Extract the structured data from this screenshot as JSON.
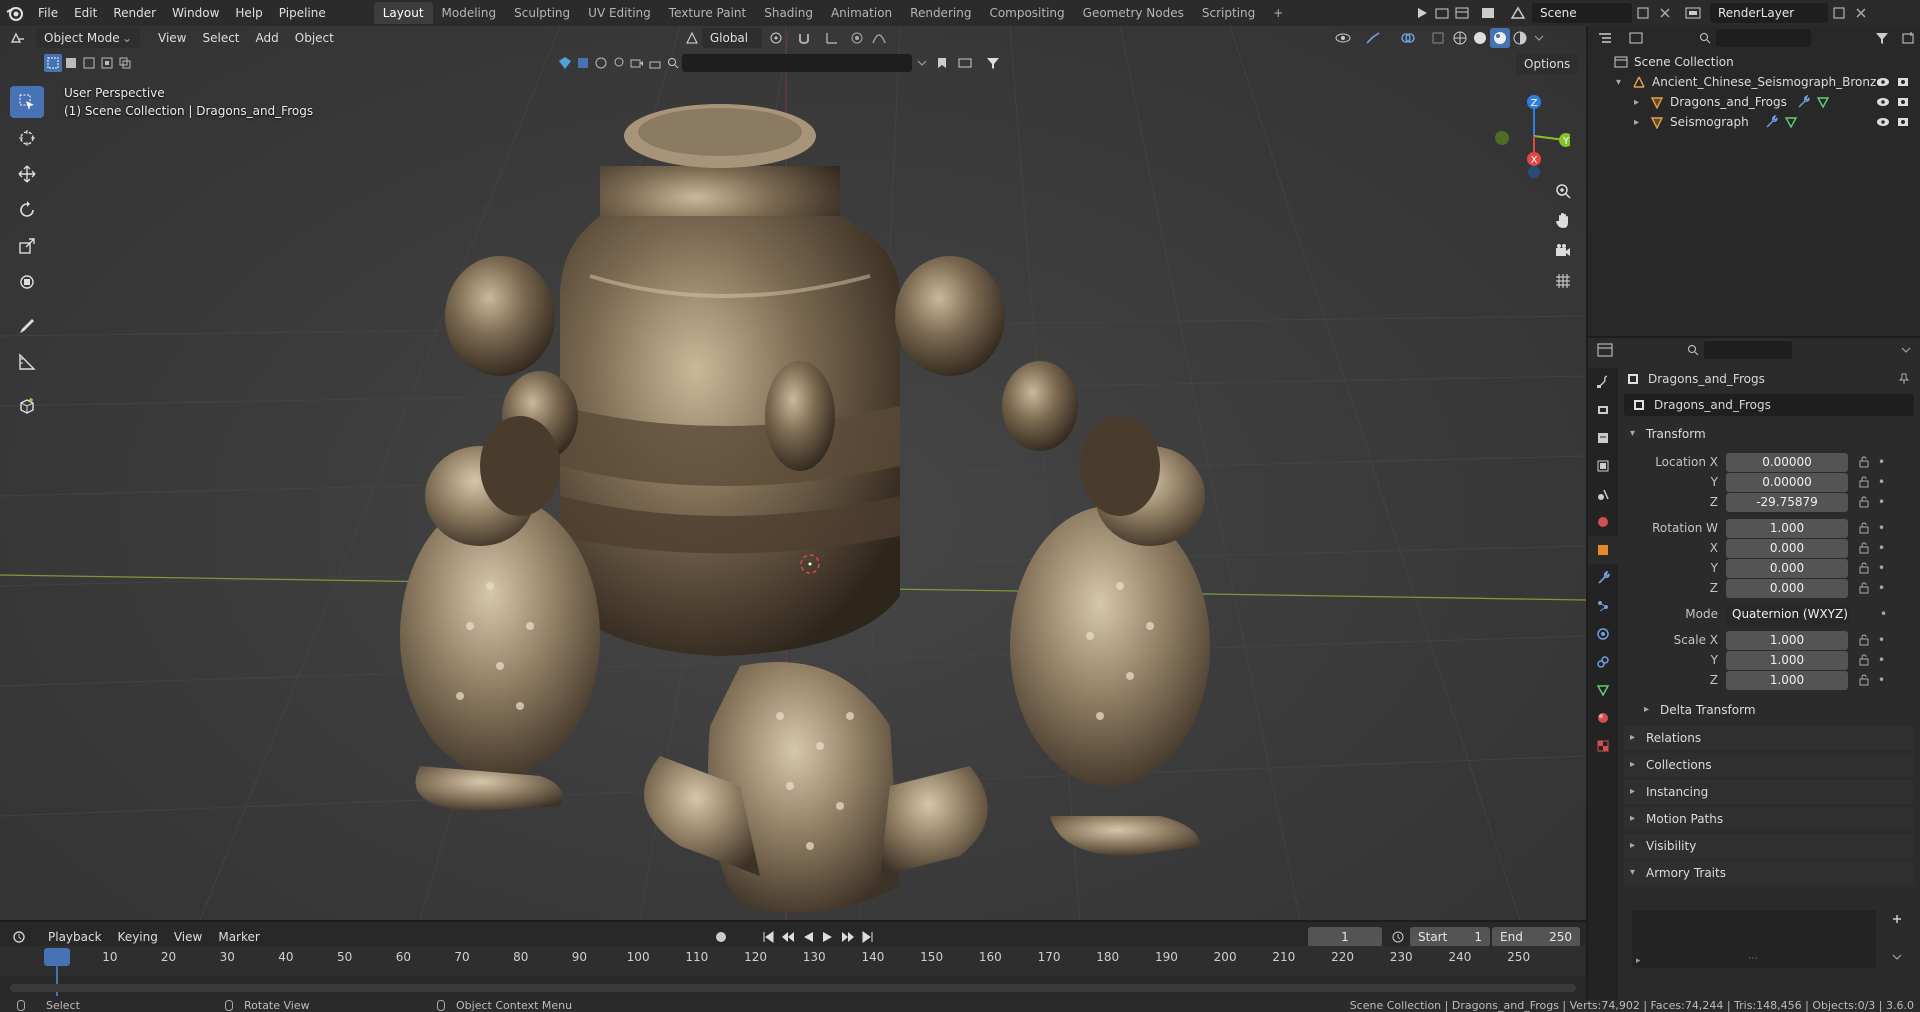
{
  "menubar": {
    "items": [
      "File",
      "Edit",
      "Render",
      "Window",
      "Help",
      "Pipeline"
    ],
    "workspaces": [
      "Layout",
      "Modeling",
      "Sculpting",
      "UV Editing",
      "Texture Paint",
      "Shading",
      "Animation",
      "Rendering",
      "Compositing",
      "Geometry Nodes",
      "Scripting"
    ],
    "active_workspace": "Layout",
    "add_tab": "+",
    "scene_name": "Scene",
    "view_layer": "RenderLayer"
  },
  "viewport": {
    "mode": "Object Mode",
    "menus": [
      "View",
      "Select",
      "Add",
      "Object"
    ],
    "orientation": "Global",
    "options_label": "Options",
    "perspective_label": "User Perspective",
    "collection_label": "(1) Scene Collection | Dragons_and_Frogs",
    "gizmo": {
      "z": "Z",
      "y": "Y",
      "x": "X"
    }
  },
  "tools": [
    "select-box-icon",
    "cursor-icon",
    "move-icon",
    "rotate-icon",
    "scale-icon",
    "transform-icon",
    "annotate-icon",
    "measure-icon",
    "add-cube-icon"
  ],
  "outliner": {
    "root": "Scene Collection",
    "items": [
      {
        "name": "Ancient_Chinese_Seismograph_Bronze",
        "level": 1
      },
      {
        "name": "Dragons_and_Frogs",
        "level": 2
      },
      {
        "name": "Seismograph",
        "level": 2
      }
    ]
  },
  "properties": {
    "object_name": "Dragons_and_Frogs",
    "data_name": "Dragons_and_Frogs",
    "transform_header": "Transform",
    "location": {
      "label": "Location X",
      "x": "0.00000",
      "y": "0.00000",
      "z": "-29.75879"
    },
    "rotation": {
      "label": "Rotation W",
      "w": "1.000",
      "x": "0.000",
      "y": "0.000",
      "z": "0.000"
    },
    "mode_label": "Mode",
    "mode_value": "Quaternion (WXYZ)",
    "scale": {
      "label": "Scale X",
      "x": "1.000",
      "y": "1.000",
      "z": "1.000"
    },
    "axis_y": "Y",
    "axis_z": "Z",
    "axis_x": "X",
    "delta_transform": "Delta Transform",
    "panels": [
      "Relations",
      "Collections",
      "Instancing",
      "Motion Paths",
      "Visibility",
      "Armory Traits"
    ]
  },
  "timeline": {
    "menus": [
      "Playback",
      "Keying",
      "View",
      "Marker"
    ],
    "current_frame": "1",
    "start_label": "Start",
    "start": "1",
    "end_label": "End",
    "end": "250",
    "ticks": [
      "1",
      "10",
      "20",
      "30",
      "40",
      "50",
      "60",
      "70",
      "80",
      "90",
      "100",
      "110",
      "120",
      "130",
      "140",
      "150",
      "160",
      "170",
      "180",
      "190",
      "200",
      "210",
      "220",
      "230",
      "240",
      "250"
    ]
  },
  "statusbar": {
    "select": "Select",
    "rotate": "Rotate View",
    "context": "Object Context Menu",
    "stats": "Scene Collection | Dragons_and_Frogs | Verts:74,902 | Faces:74,244 | Tris:148,456 | Objects:0/3 | 3.6.0"
  },
  "colors": {
    "accent": "#4772b3",
    "bronze": "#8a7a62",
    "axis_x": "#e04848",
    "axis_y": "#84c12a",
    "axis_z": "#2f7fe0"
  }
}
